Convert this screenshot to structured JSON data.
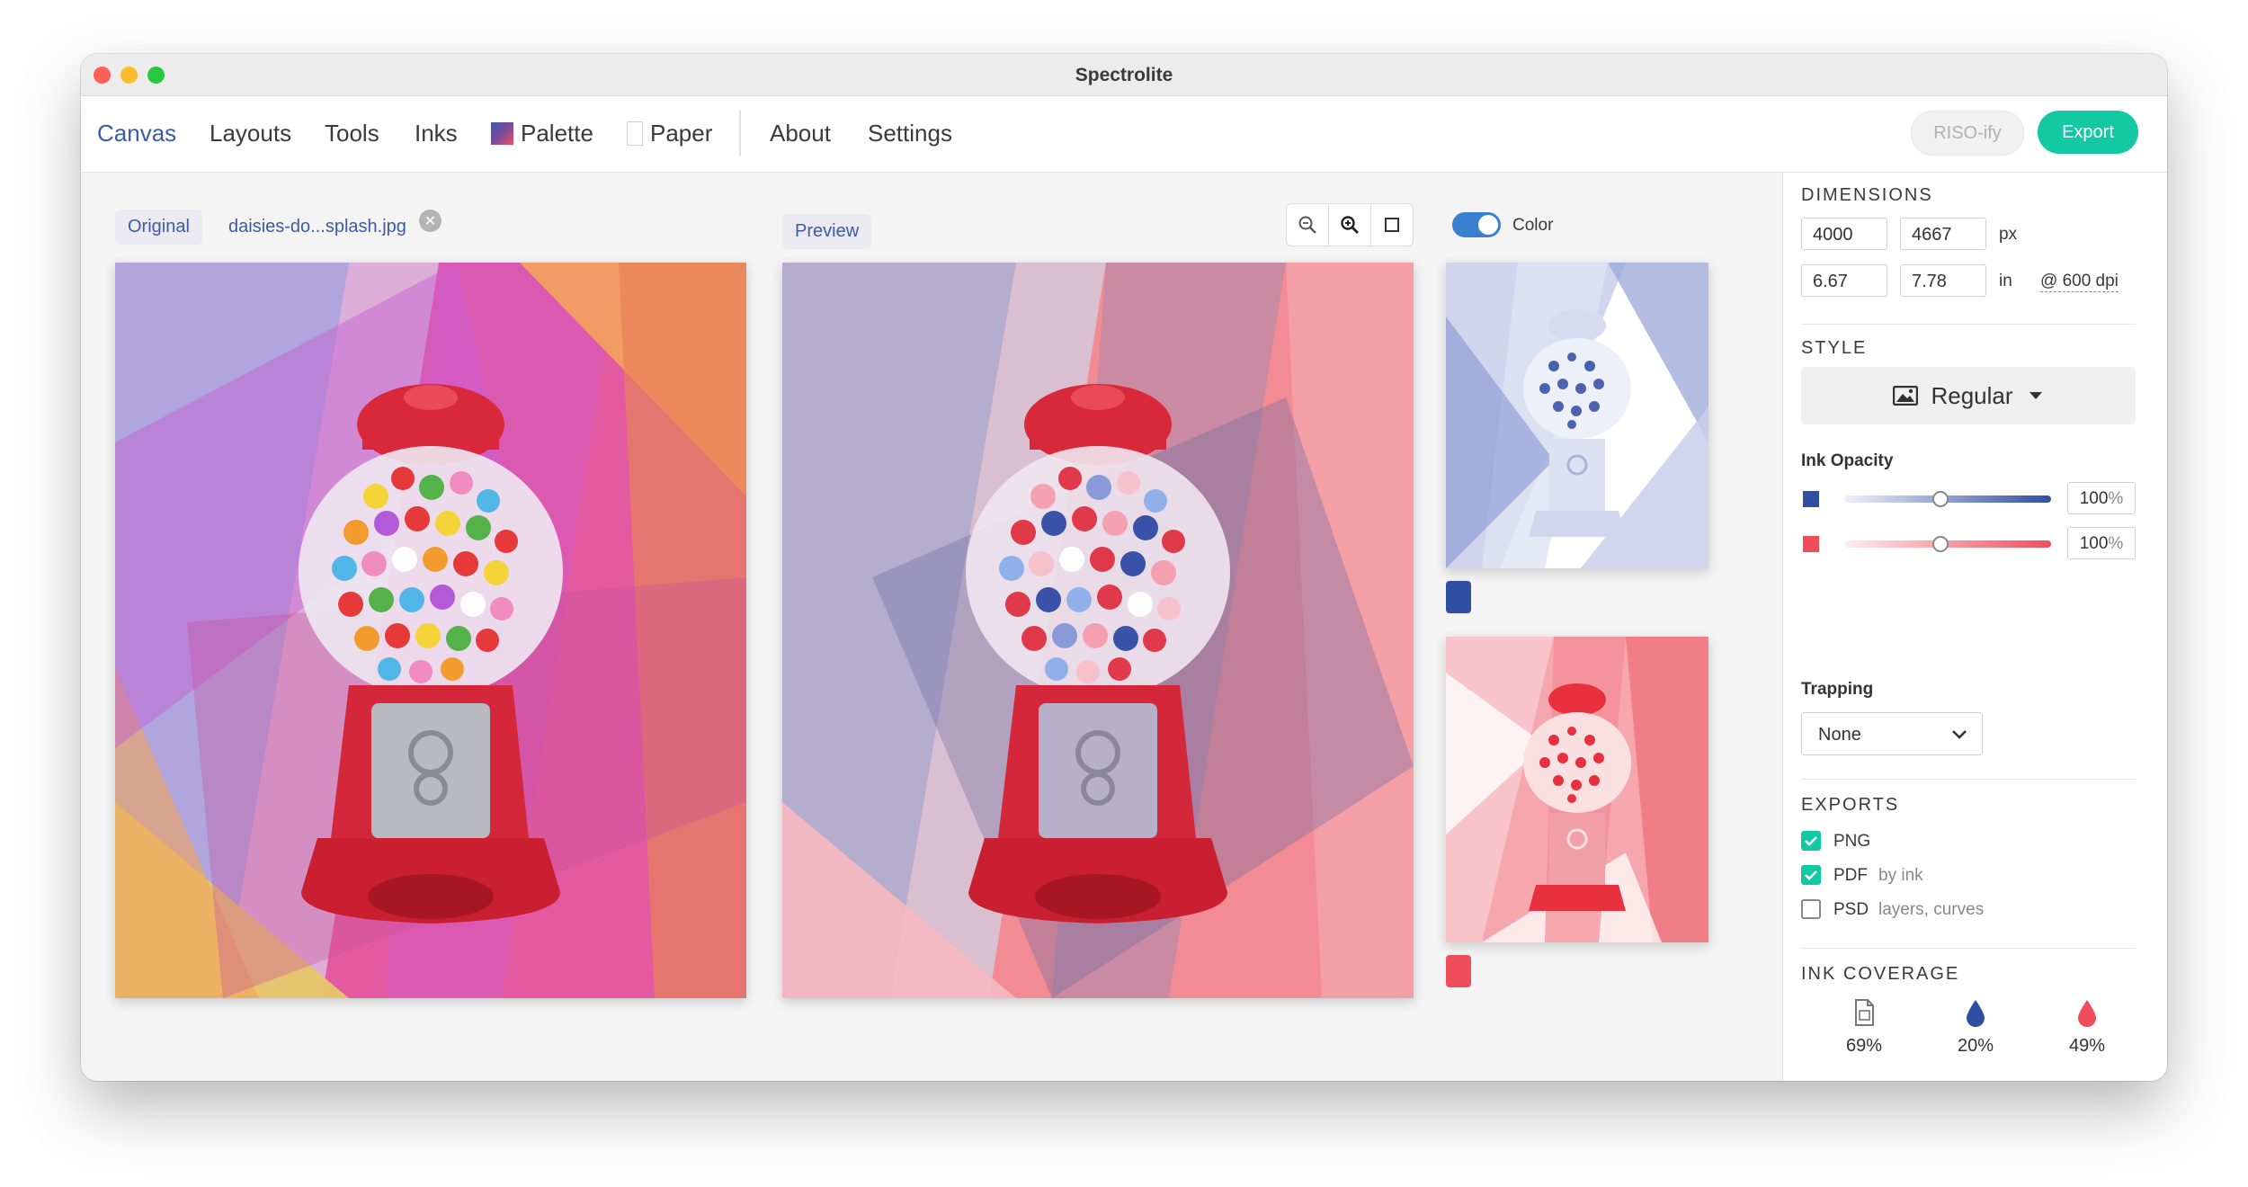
{
  "window": {
    "title": "Spectrolite"
  },
  "nav": {
    "items": [
      {
        "label": "Canvas",
        "active": true
      },
      {
        "label": "Layouts"
      },
      {
        "label": "Tools"
      },
      {
        "label": "Inks"
      },
      {
        "label": "Palette"
      },
      {
        "label": "Paper"
      },
      {
        "label": "About"
      },
      {
        "label": "Settings"
      }
    ],
    "riso_label": "RISO-ify",
    "export_label": "Export"
  },
  "canvas": {
    "original_label": "Original",
    "filename": "daisies-do...splash.jpg",
    "preview_label": "Preview",
    "color_toggle_label": "Color",
    "color_toggle_on": true
  },
  "inks": {
    "blue": "#2f4fa3",
    "red": "#ef4d5a",
    "accent": "#12c9a3"
  },
  "panel": {
    "dimensions": {
      "title": "DIMENSIONS",
      "width_px": "4000",
      "height_px": "4667",
      "px_unit": "px",
      "width_in": "6.67",
      "height_in": "7.78",
      "in_unit": "in",
      "dpi": "@ 600 dpi"
    },
    "style": {
      "title": "STYLE",
      "value": "Regular"
    },
    "ink_opacity": {
      "title": "Ink Opacity",
      "rows": [
        {
          "color": "#2f4fa3",
          "value": "100",
          "unit": "%",
          "level": 0.5
        },
        {
          "color": "#ef4d5a",
          "value": "100",
          "unit": "%",
          "level": 0.5
        }
      ]
    },
    "trapping": {
      "title": "Trapping",
      "value": "None"
    },
    "exports": {
      "title": "EXPORTS",
      "items": [
        {
          "label": "PNG",
          "note": "",
          "checked": true
        },
        {
          "label": "PDF",
          "note": "by ink",
          "checked": true
        },
        {
          "label": "PSD",
          "note": "layers, curves",
          "checked": false
        }
      ]
    },
    "coverage": {
      "title": "INK COVERAGE",
      "items": [
        {
          "icon": "paper-icon",
          "value": "69%"
        },
        {
          "icon": "blue-ink-drop-icon",
          "value": "20%"
        },
        {
          "icon": "red-ink-drop-icon",
          "value": "49%"
        }
      ]
    }
  }
}
